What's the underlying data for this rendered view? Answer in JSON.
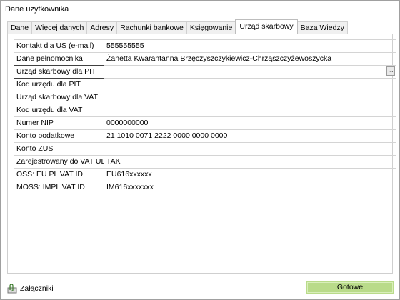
{
  "window": {
    "title": "Dane użytkownika"
  },
  "tabs": [
    {
      "label": "Dane"
    },
    {
      "label": "Więcej danych"
    },
    {
      "label": "Adresy"
    },
    {
      "label": "Rachunki bankowe"
    },
    {
      "label": "Księgowanie"
    },
    {
      "label": "Urząd skarbowy",
      "active": true
    },
    {
      "label": "Baza Wiedzy"
    }
  ],
  "fields": [
    {
      "label": "Kontakt dla US (e-mail)",
      "value": "555555555"
    },
    {
      "label": "Dane pełnomocnika",
      "value": "Żanetta Kwarantanna Brzęczyszczykiewicz-Chrząszczyżewoszycka"
    },
    {
      "label": "Urząd skarbowy dla PIT",
      "value": "",
      "browse": "..."
    },
    {
      "label": "Kod urzędu dla PIT",
      "value": ""
    },
    {
      "label": "Urząd skarbowy dla VAT",
      "value": ""
    },
    {
      "label": "Kod urzędu dla VAT",
      "value": ""
    },
    {
      "label": "Numer NIP",
      "value": "0000000000"
    },
    {
      "label": "Konto podatkowe",
      "value": "21 1010 0071 2222 0000 0000 0000"
    },
    {
      "label": "Konto ZUS",
      "value": ""
    },
    {
      "label": "Zarejestrowany do VAT UE",
      "value": "TAK"
    },
    {
      "label": "OSS: EU PL VAT ID",
      "value": "EU616xxxxxx"
    },
    {
      "label": "MOSS: IMPL VAT ID",
      "value": "IM616xxxxxxx"
    }
  ],
  "footer": {
    "attachments_label": "Załączniki",
    "attachments_icon": "paperclip-icon",
    "ok_label": "Gotowe"
  },
  "colors": {
    "ok_button": "#b9db8a",
    "ok_border": "#7fb241",
    "grid_line": "#d4d4d4"
  }
}
